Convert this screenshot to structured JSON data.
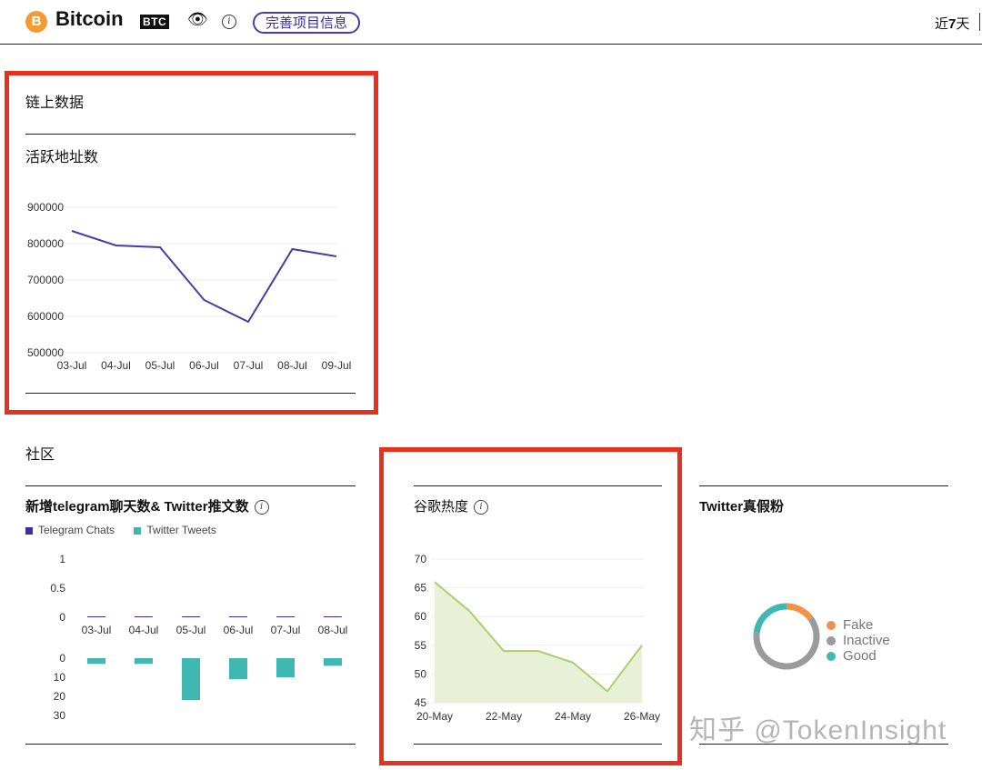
{
  "header": {
    "coin_icon": "B",
    "title": "Bitcoin",
    "ticker": "BTC",
    "eye_icon": "eye-icon",
    "info_icon": "info-icon",
    "complete_button": "完善项目信息",
    "range_prefix": "近",
    "range_number": "7",
    "range_suffix": "天"
  },
  "onchain": {
    "section_title": "链上数据",
    "chart_title": "活跃地址数"
  },
  "community": {
    "section_title": "社区",
    "tg_chart_title": "新增telegram聊天数& Twitter推文数",
    "google_title": "谷歌热度",
    "twitter_fans_title": "Twitter真假粉"
  },
  "colors": {
    "accent": "#3b2ea0",
    "line_purple": "#4a3aa8",
    "teal": "#3fb8b4",
    "google_line": "#a9cf72",
    "google_fill": "#e8f1d6",
    "orange": "#f0924a",
    "gray": "#9b9b9b",
    "highlight_red": "#e8301f"
  },
  "chart_data": [
    {
      "type": "line",
      "x": [
        "03-Jul",
        "04-Jul",
        "05-Jul",
        "06-Jul",
        "07-Jul",
        "08-Jul",
        "09-Jul"
      ],
      "y": [
        835000,
        795000,
        790000,
        645000,
        585000,
        785000,
        765000
      ],
      "yticks": [
        "900000",
        "800000",
        "700000",
        "600000",
        "500000"
      ],
      "ylim": [
        500000,
        900000
      ],
      "grid": true
    },
    {
      "type": "bar",
      "categories": [
        "03-Jul",
        "04-Jul",
        "05-Jul",
        "06-Jul",
        "07-Jul",
        "08-Jul"
      ],
      "series": [
        {
          "name": "Telegram Chats",
          "values": [
            0,
            0,
            0,
            0,
            0,
            0
          ]
        },
        {
          "name": "Twitter Tweets",
          "values": [
            3,
            3,
            22,
            11,
            10,
            4
          ]
        }
      ],
      "top_yticks": [
        "1",
        "0.5",
        "0"
      ],
      "bottom_yticks": [
        "0",
        "10",
        "20",
        "30"
      ],
      "legend_position": "top-left"
    },
    {
      "type": "area",
      "x": [
        "20-May",
        "21-May",
        "22-May",
        "23-May",
        "24-May",
        "25-May",
        "26-May"
      ],
      "xticks": [
        "20-May",
        "22-May",
        "24-May",
        "26-May"
      ],
      "y": [
        66,
        61,
        54,
        54,
        52,
        47,
        55
      ],
      "yticks": [
        "70",
        "65",
        "60",
        "55",
        "50",
        "45"
      ],
      "ylim": [
        45,
        70
      ],
      "grid": true
    },
    {
      "type": "pie",
      "labels": [
        "Fake",
        "Inactive",
        "Good"
      ],
      "values": [
        15,
        62,
        23
      ],
      "donut": true,
      "legend_position": "right"
    }
  ],
  "watermark": "知乎 @TokenInsight"
}
